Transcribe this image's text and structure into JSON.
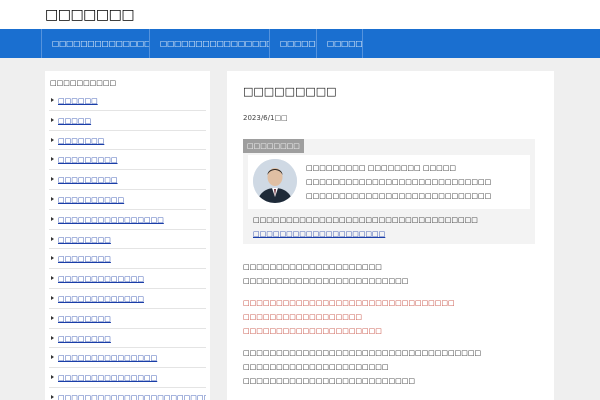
{
  "header": {
    "site_title": "□□□□□□□"
  },
  "nav": {
    "items": [
      {
        "label": "□□□□□□□□□□□□□□□□□□□□□"
      },
      {
        "label": "□□□□□□□□□□□□□□□□□□□□□□□"
      },
      {
        "label": "□□□□□□"
      },
      {
        "label": "□□□□□□"
      }
    ]
  },
  "sidebar": {
    "title": "□□□□□□□□□□",
    "items": [
      {
        "label": "□□□□□□"
      },
      {
        "label": "□□□□□"
      },
      {
        "label": "□□□□□□□"
      },
      {
        "label": "□□□□□□□□□"
      },
      {
        "label": "□□□□□□□□□"
      },
      {
        "label": "□□□□□□□□□□"
      },
      {
        "label": "□□□□□□□□□□□□□□□□"
      },
      {
        "label": "□□□□□□□□"
      },
      {
        "label": "□□□□□□□□"
      },
      {
        "label": "□□□□□□□□□□□□□"
      },
      {
        "label": "□□□□□□□□□□□□□"
      },
      {
        "label": "□□□□□□□□"
      },
      {
        "label": "□□□□□□□□"
      },
      {
        "label": "□□□□□□□□□□□□□□□"
      },
      {
        "label": "□□□□□□□□□□□□□□□"
      },
      {
        "label": "□□□□□□□□□□□□□□□□□□□□□□□□□□"
      }
    ]
  },
  "post": {
    "title": "□□□□□□□□□",
    "date": "2023/6/1□□",
    "author_label": "□□□□□□□□",
    "author_line1": "□□□□□□□□□ □□□□□□□□ □□□□□",
    "author_line2": "□□□□□□□□□□□□□□□□□□□□□□□□□□□□",
    "author_line3": "□□□□□□□□□□□□□□□□□□□□□□□□□□□□",
    "author_desc": "□□□□□□□□□□□□□□□□□□□□□□□□□□□□□□□□□□",
    "author_link": "□□□□□□□□□□□□□□□□□□□□",
    "body": [
      "□□□□□□□□□□□□□□□□□□□□□",
      "□□□□□□□□□□□□□□□□□□□□□□□□□",
      "□□□□□□□□□□□□□□□□□□□□□□□□□□□□□□□□",
      "□□□□□□□□□□□□□□□□□□",
      "□□□□□□□□□□□□□□□□□□□□□",
      "□□□□□□□□□□□□□□□□□□□□□□□□□□□□□□□□□□□□",
      "□□□□□□□□□□□□□□□□□□□□□□",
      "□□□□□□□□□□□□□□□□□□□□□□□□□□"
    ]
  },
  "colors": {
    "nav_bg": "#1a6fd0",
    "link": "#1a3ea8",
    "emphasis_red": "#c0392b",
    "page_bg": "#efefef"
  }
}
